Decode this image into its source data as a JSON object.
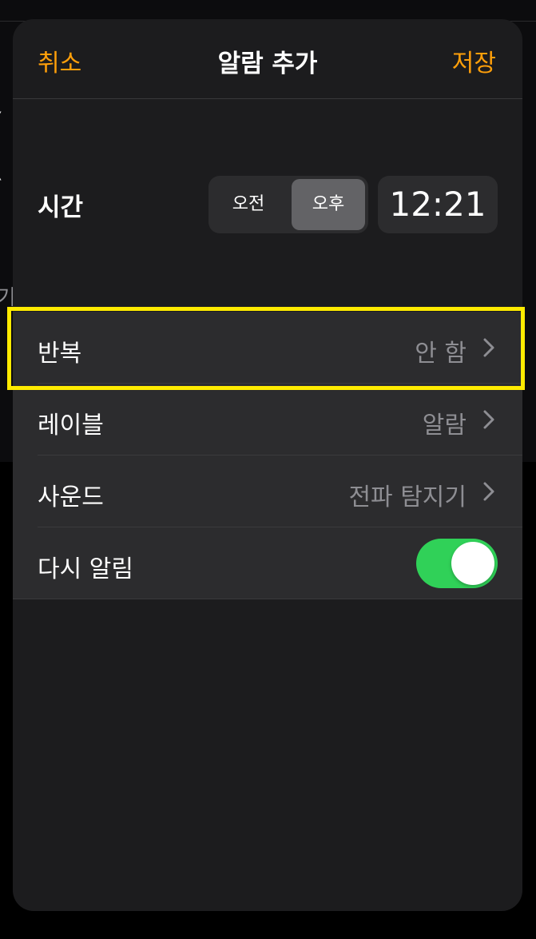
{
  "background": {
    "partial_glyph_large": "(",
    "partial_glyph_small": "기"
  },
  "nav": {
    "cancel_label": "취소",
    "title": "알람 추가",
    "save_label": "저장"
  },
  "time": {
    "label": "시간",
    "am_label": "오전",
    "pm_label": "오후",
    "selected_period": "오후",
    "value": "12:21"
  },
  "settings": {
    "repeat": {
      "label": "반복",
      "value": "안 함"
    },
    "label": {
      "label": "레이블",
      "value": "알람"
    },
    "sound": {
      "label": "사운드",
      "value": "전파 탐지기"
    },
    "snooze": {
      "label": "다시 알림",
      "enabled": true
    }
  },
  "colors": {
    "accent": "#ff9f0a",
    "toggle_on": "#30d158",
    "sheet_bg": "#1c1c1e",
    "row_bg": "#2c2c2e",
    "highlight": "#ffeb00",
    "secondary_text": "#8e8e93"
  },
  "icons": {
    "chevron": "chevron-right-icon"
  }
}
